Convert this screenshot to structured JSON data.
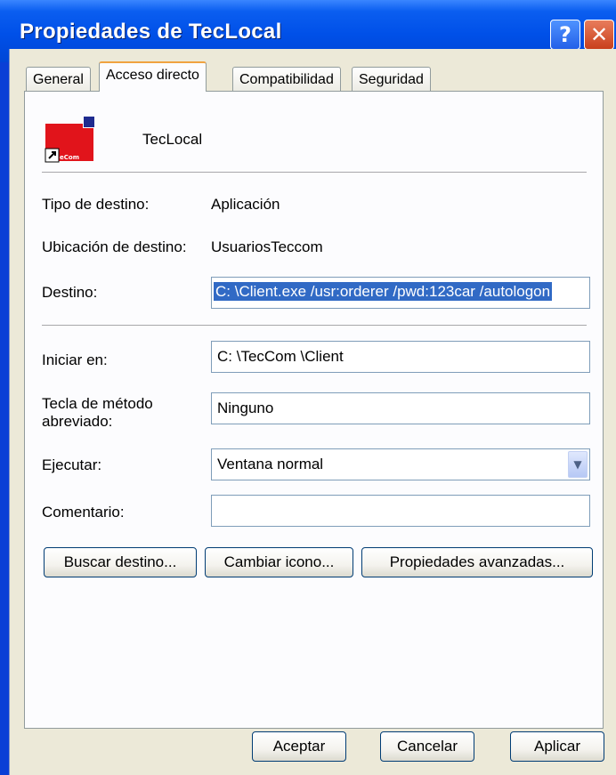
{
  "window": {
    "title": "Propiedades de TecLocal",
    "help_glyph": "?",
    "close_glyph": "✕"
  },
  "tabs": [
    {
      "label": "General",
      "active": false
    },
    {
      "label": "Acceso directo",
      "active": true
    },
    {
      "label": "Compatibilidad",
      "active": false
    },
    {
      "label": "Seguridad",
      "active": false
    }
  ],
  "shortcut": {
    "name": "TecLocal",
    "icon_badge": "eCom",
    "icon_name": "teclocal-app-icon"
  },
  "fields": {
    "target_type": {
      "label": "Tipo de destino:",
      "value": "Aplicación"
    },
    "target_location": {
      "label": "Ubicación de destino:",
      "value": "UsuariosTeccom"
    },
    "target": {
      "label": "Destino:",
      "value": "C: \\Client.exe /usr:orderer /pwd:123car /autologon"
    },
    "start_in": {
      "label": "Iniciar en:",
      "value": "C: \\TecCom \\Client"
    },
    "shortcut_key": {
      "label": "Tecla de método abreviado:",
      "value": "Ninguno"
    },
    "run": {
      "label": "Ejecutar:",
      "value": "Ventana normal"
    },
    "comment": {
      "label": "Comentario:",
      "value": ""
    }
  },
  "buttons": {
    "find_target": "Buscar destino...",
    "change_icon": "Cambiar icono...",
    "advanced": "Propiedades avanzadas...",
    "ok": "Aceptar",
    "cancel": "Cancelar",
    "apply": "Aplicar"
  },
  "colors": {
    "title_bar": "#0050e8",
    "dialog_face": "#ece9d8",
    "selection": "#316ac5",
    "close_button": "#c9401c",
    "active_tab_accent": "#f0a340"
  }
}
